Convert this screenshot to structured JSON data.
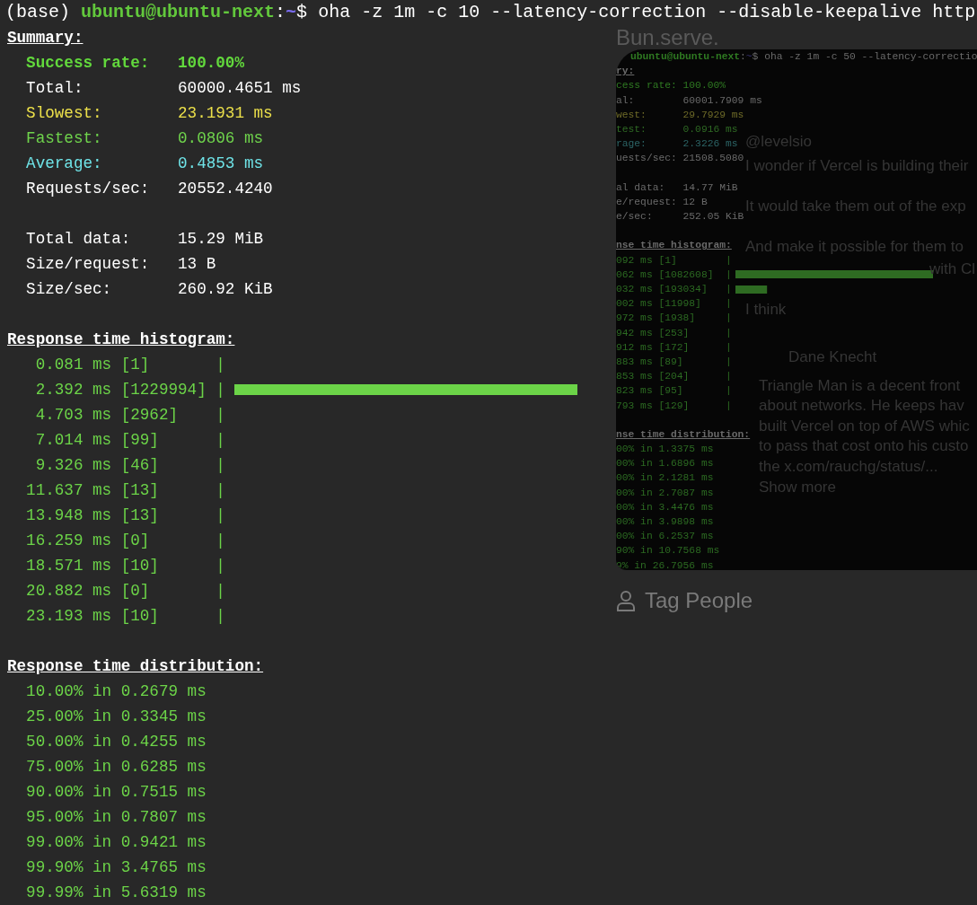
{
  "prompt": {
    "env": "(base)",
    "user_host": "ubuntu@ubuntu-next",
    "separator": ":",
    "path": "~",
    "symbol": "$",
    "command": "oha -z 1m -c 10 --latency-correction --disable-keepalive http"
  },
  "summary": {
    "heading": "Summary:",
    "groups": [
      {
        "items": [
          {
            "label": "Success rate:",
            "value": "100.00%",
            "color": "#62d83c",
            "bold": true
          },
          {
            "label": "Total:",
            "value": "60000.4651 ms",
            "color": "#ffffff",
            "bold": false
          },
          {
            "label": "Slowest:",
            "value": "23.1931 ms",
            "color": "#ece04a",
            "bold": false
          },
          {
            "label": "Fastest:",
            "value": "0.0806 ms",
            "color": "#6fd44c",
            "bold": false
          },
          {
            "label": "Average:",
            "value": "0.4853 ms",
            "color": "#6fe4e8",
            "bold": false
          },
          {
            "label": "Requests/sec:",
            "value": "20552.4240",
            "color": "#ffffff",
            "bold": false
          }
        ]
      },
      {
        "items": [
          {
            "label": "Total data:",
            "value": "15.29 MiB",
            "color": "#ffffff",
            "bold": false
          },
          {
            "label": "Size/request:",
            "value": "13 B",
            "color": "#ffffff",
            "bold": false
          },
          {
            "label": "Size/sec:",
            "value": "260.92 KiB",
            "color": "#ffffff",
            "bold": false
          }
        ]
      }
    ]
  },
  "histogram": {
    "heading": "Response time histogram:",
    "rows": [
      {
        "value": "0.081 ms",
        "count": "[1]",
        "axis": "|"
      },
      {
        "value": "2.392 ms",
        "count": "[1229994]",
        "axis": "|",
        "level": 1
      },
      {
        "value": "4.703 ms",
        "count": "[2962]",
        "axis": "|"
      },
      {
        "value": "7.014 ms",
        "count": "[99]",
        "axis": "|"
      },
      {
        "value": "9.326 ms",
        "count": "[46]",
        "axis": "|"
      },
      {
        "value": "11.637 ms",
        "count": "[13]",
        "axis": "|"
      },
      {
        "value": "13.948 ms",
        "count": "[13]",
        "axis": "|"
      },
      {
        "value": "16.259 ms",
        "count": "[0]",
        "axis": "|"
      },
      {
        "value": "18.571 ms",
        "count": "[10]",
        "axis": "|"
      },
      {
        "value": "20.882 ms",
        "count": "[0]",
        "axis": "|"
      },
      {
        "value": "23.193 ms",
        "count": "[10]",
        "axis": "|"
      }
    ]
  },
  "distribution": {
    "heading": "Response time distribution:",
    "rows": [
      "10.00% in 0.2679 ms",
      "25.00% in 0.3345 ms",
      "50.00% in 0.4255 ms",
      "75.00% in 0.6285 ms",
      "90.00% in 0.7515 ms",
      "95.00% in 0.7807 ms",
      "99.00% in 0.9421 ms",
      "99.90% in 3.4765 ms",
      "99.99% in 5.6319 ms"
    ]
  },
  "post": {
    "title": "Bun.serve.",
    "screenshot": {
      "prompt": {
        "user_host": "ubuntu@ubuntu-next",
        "separator": ":",
        "path": "~",
        "symbol": "$",
        "command": "oha -z 1m -c 50 --latency-correctio"
      },
      "summary_heading": "ry:",
      "groups": [
        {
          "items": [
            {
              "label": "cess rate:",
              "value": "100.00%",
              "color": "#2f7a22"
            },
            {
              "label": "al:",
              "value": "60001.7909 ms",
              "color": "#6a6a6a"
            },
            {
              "label": "west:",
              "value": "29.7929 ms",
              "color": "#6e6a28"
            },
            {
              "label": "test:",
              "value": "0.0916 ms",
              "color": "#2f6a24"
            },
            {
              "label": "rage:",
              "value": "2.3226 ms",
              "color": "#2c6466"
            },
            {
              "label": "uests/sec:",
              "value": "21508.5080",
              "color": "#6a6a6a"
            }
          ]
        },
        {
          "items": [
            {
              "label": "al data:",
              "value": "14.77 MiB",
              "color": "#6a6a6a"
            },
            {
              "label": "e/request:",
              "value": "12 B",
              "color": "#6a6a6a"
            },
            {
              "label": "e/sec:",
              "value": "252.05 KiB",
              "color": "#6a6a6a"
            }
          ]
        }
      ],
      "histogram_heading": "nse time histogram:",
      "histogram": [
        {
          "value": "092 ms",
          "count": "[1]",
          "axis": "|"
        },
        {
          "value": "062 ms",
          "count": "[1082608]",
          "axis": "|",
          "level": 1
        },
        {
          "value": "032 ms",
          "count": "[193034]",
          "axis": "|",
          "level": 0.16
        },
        {
          "value": "002 ms",
          "count": "[11998]",
          "axis": "|"
        },
        {
          "value": "972 ms",
          "count": "[1938]",
          "axis": "|"
        },
        {
          "value": "942 ms",
          "count": "[253]",
          "axis": "|"
        },
        {
          "value": "912 ms",
          "count": "[172]",
          "axis": "|"
        },
        {
          "value": "883 ms",
          "count": "[89]",
          "axis": "|"
        },
        {
          "value": "853 ms",
          "count": "[204]",
          "axis": "|"
        },
        {
          "value": "823 ms",
          "count": "[95]",
          "axis": "|"
        },
        {
          "value": "793 ms",
          "count": "[129]",
          "axis": "|"
        }
      ],
      "distribution_heading": "nse time distribution:",
      "distribution": [
        "00% in 1.3375 ms",
        "00% in 1.6896 ms",
        "00% in 2.1281 ms",
        "00% in 2.7087 ms",
        "00% in 3.4476 ms",
        "00% in 3.9898 ms",
        "00% in 6.2537 ms",
        "90% in 10.7568 ms",
        "9% in 26.7956 ms"
      ]
    },
    "overlay_texts": [
      "@levelsio",
      "I wonder if Vercel is building their",
      "It would take them out of the exp",
      "And make it possible for them to",
      "with Cl",
      "I think",
      "Dane Knecht",
      "Triangle Man is a decent front",
      "about networks. He keeps hav",
      "built Vercel on top of AWS whic",
      "to pass that cost onto his custo",
      "the x.com/rauchg/status/...",
      "Show more"
    ],
    "tag_people": "Tag People"
  }
}
